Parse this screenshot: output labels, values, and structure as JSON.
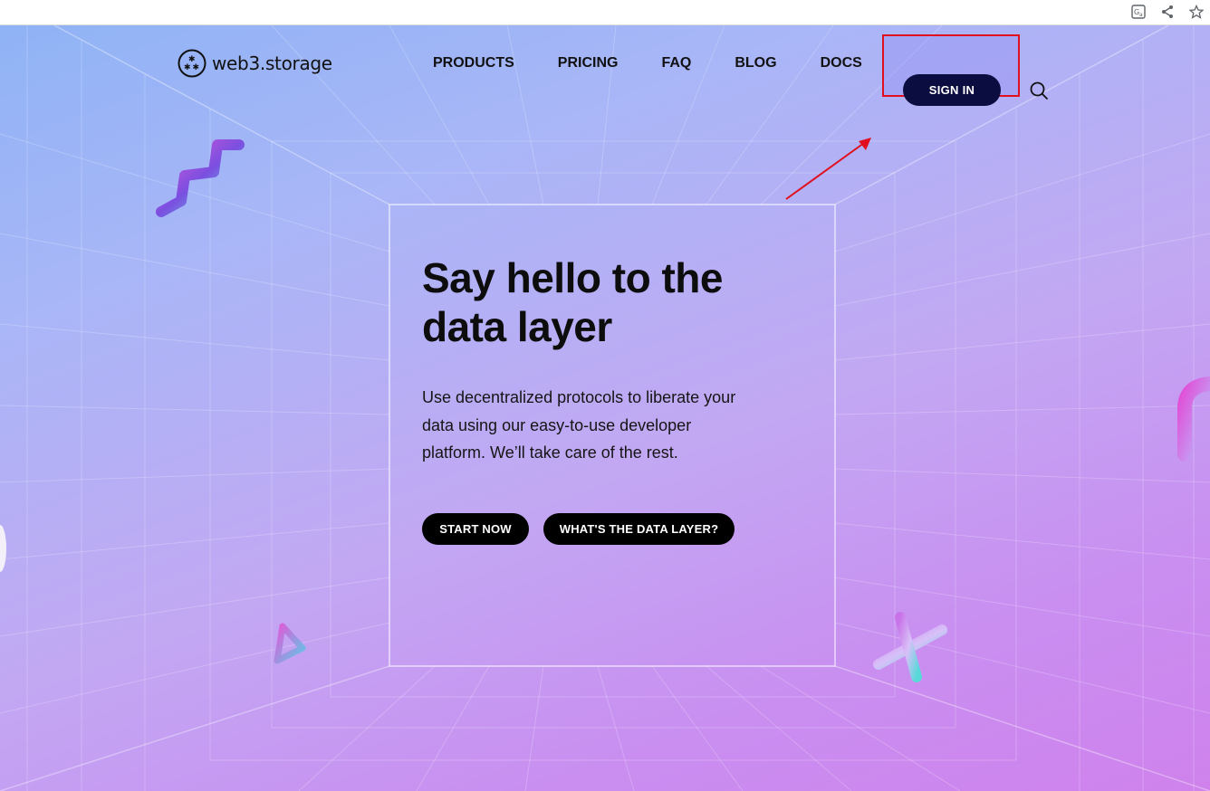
{
  "browser": {
    "icons": [
      "translate-icon",
      "share-icon",
      "bookmark-star-icon"
    ]
  },
  "header": {
    "logo_text": "web3.storage",
    "nav": [
      {
        "label": "PRODUCTS"
      },
      {
        "label": "PRICING"
      },
      {
        "label": "FAQ"
      },
      {
        "label": "BLOG"
      },
      {
        "label": "DOCS"
      }
    ],
    "signin_label": "SIGN IN"
  },
  "hero": {
    "title": "Say hello to the data layer",
    "description": "Use decentralized protocols to liberate your data using our easy-to-use developer platform. We’ll take care of the rest.",
    "buttons": {
      "start": "START NOW",
      "data_layer": "WHAT'S THE DATA LAYER?"
    }
  },
  "colors": {
    "signin_bg": "#0b0c3f",
    "highlight_border": "#e01020",
    "button_bg": "#000000",
    "text": "#111111"
  }
}
